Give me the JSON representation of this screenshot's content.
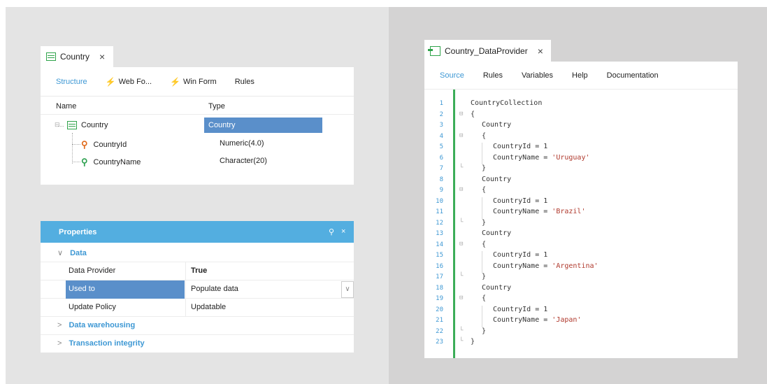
{
  "structure": {
    "tab": {
      "title": "Country",
      "close": "×"
    },
    "toolbar": [
      {
        "label": "Structure",
        "active": true,
        "icon": ""
      },
      {
        "label": "Web Fo...",
        "active": false,
        "icon": "bolt-icon"
      },
      {
        "label": "Win Form",
        "active": false,
        "icon": "bolt-icon"
      },
      {
        "label": "Rules",
        "active": false,
        "icon": ""
      }
    ],
    "columns": {
      "name": "Name",
      "type": "Type"
    },
    "rows": [
      {
        "name": "Country",
        "type": "Country",
        "icon": "table-icon"
      },
      {
        "name": "CountryId",
        "type": "Numeric(4.0)",
        "icon": "key-icon"
      },
      {
        "name": "CountryName",
        "type": "Character(20)",
        "icon": "attribute-icon"
      }
    ]
  },
  "properties": {
    "title": "Properties",
    "pin": "⚲",
    "close": "×",
    "categories": [
      {
        "label": "Data",
        "expanded": true
      },
      {
        "label": "Data warehousing",
        "expanded": false
      },
      {
        "label": "Transaction integrity",
        "expanded": false
      }
    ],
    "rows": [
      {
        "key": "Data Provider",
        "value": "True"
      },
      {
        "key": "Used to",
        "value": "Populate data"
      },
      {
        "key": "Update Policy",
        "value": "Updatable"
      }
    ]
  },
  "dataprovider": {
    "tab": {
      "title": "Country_DataProvider",
      "close": "×"
    },
    "toolbar": [
      {
        "label": "Source",
        "active": true
      },
      {
        "label": "Rules",
        "active": false
      },
      {
        "label": "Variables",
        "active": false
      },
      {
        "label": "Help",
        "active": false
      },
      {
        "label": "Documentation",
        "active": false
      }
    ],
    "lines": [
      {
        "n": "1",
        "code": "CountryCollection",
        "str": ""
      },
      {
        "n": "2",
        "code": "{",
        "str": ""
      },
      {
        "n": "3",
        "code": "Country",
        "str": ""
      },
      {
        "n": "4",
        "code": "{",
        "str": ""
      },
      {
        "n": "5",
        "code": "CountryId = 1",
        "str": ""
      },
      {
        "n": "6",
        "code": "CountryName = ",
        "str": "'Uruguay'"
      },
      {
        "n": "7",
        "code": "}",
        "str": ""
      },
      {
        "n": "8",
        "code": "Country",
        "str": ""
      },
      {
        "n": "9",
        "code": "{",
        "str": ""
      },
      {
        "n": "10",
        "code": "CountryId = 1",
        "str": ""
      },
      {
        "n": "11",
        "code": "CountryName = ",
        "str": "'Brazil'"
      },
      {
        "n": "12",
        "code": "}",
        "str": ""
      },
      {
        "n": "13",
        "code": "Country",
        "str": ""
      },
      {
        "n": "14",
        "code": "{",
        "str": ""
      },
      {
        "n": "15",
        "code": "CountryId = 1",
        "str": ""
      },
      {
        "n": "16",
        "code": "CountryName = ",
        "str": "'Argentina'"
      },
      {
        "n": "17",
        "code": "}",
        "str": ""
      },
      {
        "n": "18",
        "code": "Country",
        "str": ""
      },
      {
        "n": "19",
        "code": "{",
        "str": ""
      },
      {
        "n": "20",
        "code": "CountryId = 1",
        "str": ""
      },
      {
        "n": "21",
        "code": "CountryName = ",
        "str": "'Japan'"
      },
      {
        "n": "22",
        "code": "}",
        "str": ""
      },
      {
        "n": "23",
        "code": "}",
        "str": ""
      }
    ]
  },
  "colors": {
    "accent": "#3e98d4",
    "selection": "#5a8fca",
    "props_header": "#53aee0",
    "gutter": "#3cad58",
    "string": "#b03a2e"
  }
}
